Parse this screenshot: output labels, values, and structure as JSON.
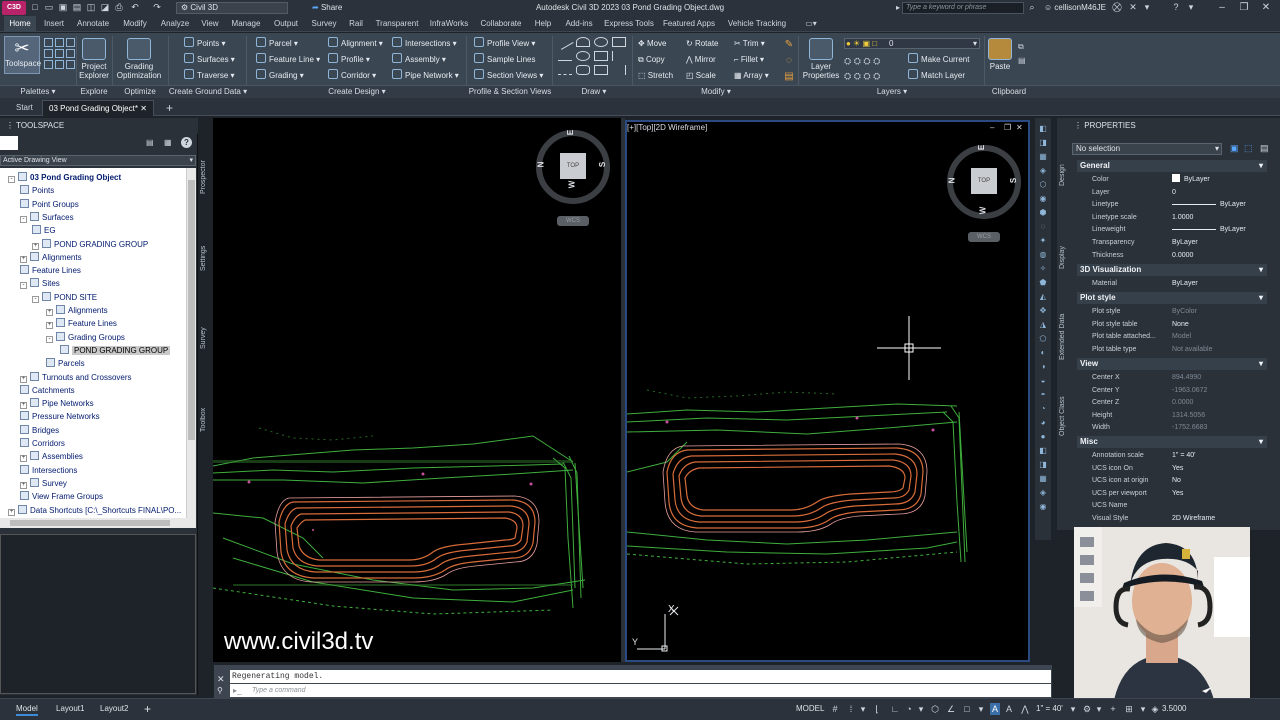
{
  "titlebar": {
    "app_icon": "C3D",
    "workspace": "Civil 3D",
    "share": "Share",
    "title": "Autodesk Civil 3D 2023    03 Pond Grading Object.dwg",
    "search_placeholder": "Type a keyword or phrase",
    "user": "cellisonM46JE"
  },
  "ribbon_tabs": [
    "Home",
    "Insert",
    "Annotate",
    "Modify",
    "Analyze",
    "View",
    "Manage",
    "Output",
    "Survey",
    "Rail",
    "Transparent",
    "InfraWorks",
    "Collaborate",
    "Help",
    "Add-ins",
    "Express Tools",
    "Featured Apps",
    "Vehicle Tracking"
  ],
  "ribbon": {
    "toolspace": "Toolspace",
    "project_explorer": "Project Explorer",
    "grading_optimization": "Grading Optimization",
    "ground_data": [
      "Points",
      "Surfaces",
      "Traverse"
    ],
    "design_1": [
      "Parcel",
      "Feature Line",
      "Grading"
    ],
    "design_2": [
      "Alignment",
      "Profile",
      "Corridor"
    ],
    "design_3": [
      "Intersections",
      "Assembly",
      "Pipe Network"
    ],
    "profile_section": [
      "Profile View",
      "Sample Lines",
      "Section Views"
    ],
    "modify_1": [
      "Move",
      "Copy",
      "Stretch"
    ],
    "modify_2": [
      "Rotate",
      "Mirror",
      "Scale"
    ],
    "modify_3": [
      "Trim",
      "Fillet",
      "Array"
    ],
    "layer_properties": "Layer Properties",
    "layer_value": "0",
    "layer_cmds": [
      "Make Current",
      "Match Layer"
    ],
    "paste": "Paste"
  },
  "panels": [
    "Palettes",
    "Explore",
    "Optimize",
    "Create Ground Data",
    "Create Design",
    "Profile & Section Views",
    "Draw",
    "Modify",
    "Layers",
    "Clipboard"
  ],
  "doc_tabs": {
    "start": "Start",
    "active": "03 Pond Grading Object*"
  },
  "toolspace": {
    "title": "TOOLSPACE",
    "view": "Active Drawing View",
    "side_tabs": [
      "Prospector",
      "Settings",
      "Survey",
      "Toolbox"
    ],
    "tree": [
      {
        "label": "03 Pond Grading Object",
        "bold": true
      },
      {
        "label": "Points"
      },
      {
        "label": "Point Groups"
      },
      {
        "label": "Surfaces"
      },
      {
        "label": "EG"
      },
      {
        "label": "POND GRADING GROUP"
      },
      {
        "label": "Alignments"
      },
      {
        "label": "Feature Lines"
      },
      {
        "label": "Sites"
      },
      {
        "label": "POND SITE"
      },
      {
        "label": "Alignments"
      },
      {
        "label": "Feature Lines"
      },
      {
        "label": "Grading Groups"
      },
      {
        "label": "POND GRADING GROUP",
        "selected": true
      },
      {
        "label": "Parcels"
      },
      {
        "label": "Turnouts and Crossovers"
      },
      {
        "label": "Catchments"
      },
      {
        "label": "Pipe Networks"
      },
      {
        "label": "Pressure Networks"
      },
      {
        "label": "Bridges"
      },
      {
        "label": "Corridors"
      },
      {
        "label": "Assemblies"
      },
      {
        "label": "Intersections"
      },
      {
        "label": "Survey"
      },
      {
        "label": "View Frame Groups"
      },
      {
        "label": "Data Shortcuts [C:\\_Shortcuts FINAL\\PO..."
      }
    ]
  },
  "viewport": {
    "label": "[+][Top][2D Wireframe]",
    "viewcube": {
      "top": "TOP",
      "n": "N",
      "s": "S",
      "e": "E",
      "w": "W",
      "wcs": "WCS"
    },
    "watermark": "www.civil3d.tv",
    "ucs": {
      "x": "X",
      "y": "Y"
    }
  },
  "command": {
    "history": "Regenerating model.",
    "placeholder": "Type a command"
  },
  "properties": {
    "title": "PROPERTIES",
    "selection": "No selection",
    "side_tabs": [
      "Design",
      "Display",
      "Extended Data",
      "Object Class"
    ],
    "sections": [
      {
        "name": "General",
        "rows": [
          [
            "Color",
            "ByLayer"
          ],
          [
            "Layer",
            "0"
          ],
          [
            "Linetype",
            "ByLayer"
          ],
          [
            "Linetype scale",
            "1.0000"
          ],
          [
            "Lineweight",
            "ByLayer"
          ],
          [
            "Transparency",
            "ByLayer"
          ],
          [
            "Thickness",
            "0.0000"
          ]
        ]
      },
      {
        "name": "3D Visualization",
        "rows": [
          [
            "Material",
            "ByLayer"
          ]
        ]
      },
      {
        "name": "Plot style",
        "rows": [
          [
            "Plot style",
            "ByColor"
          ],
          [
            "Plot style table",
            "None"
          ],
          [
            "Plot table attached...",
            "Model"
          ],
          [
            "Plot table type",
            "Not available"
          ]
        ]
      },
      {
        "name": "View",
        "rows": [
          [
            "Center X",
            "894.4990"
          ],
          [
            "Center Y",
            "-1963.0672"
          ],
          [
            "Center Z",
            "0.0000"
          ],
          [
            "Height",
            "1314.5056"
          ],
          [
            "Width",
            "-1752.6683"
          ]
        ]
      },
      {
        "name": "Misc",
        "rows": [
          [
            "Annotation scale",
            "1\" = 40'"
          ],
          [
            "UCS icon On",
            "Yes"
          ],
          [
            "UCS icon at origin",
            "No"
          ],
          [
            "UCS per viewport",
            "Yes"
          ],
          [
            "UCS Name",
            ""
          ],
          [
            "Visual Style",
            "2D Wireframe"
          ]
        ]
      }
    ]
  },
  "status": {
    "layouts": [
      "Model",
      "Layout1",
      "Layout2"
    ],
    "model": "MODEL",
    "scale": "1\" = 40'",
    "value": "3.5000"
  },
  "colors": {
    "accent": "#3d8bd8",
    "drawing_green": "#3fae3c",
    "drawing_orange": "#d86c3a",
    "app_badge": "#b8236a"
  }
}
